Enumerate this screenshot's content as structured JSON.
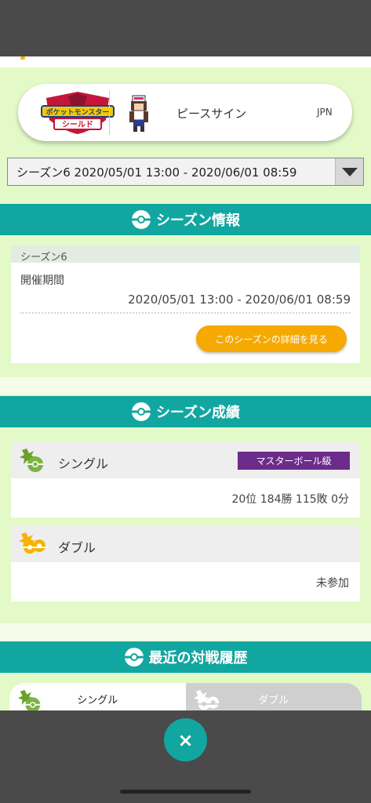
{
  "profile": {
    "game_logo_text_top": "ポケットモンスター",
    "game_logo_text_bottom": "シールド",
    "trainer_name": "ピースサイン",
    "region": "JPN"
  },
  "season_selector": {
    "selected": "シーズン6 2020/05/01 13:00 - 2020/06/01 08:59"
  },
  "season_info": {
    "header": "シーズン情報",
    "season_label": "シーズン6",
    "period_label": "開催期間",
    "period_value": "2020/05/01 13:00 - 2020/06/01 08:59",
    "detail_button": "このシーズンの詳細を見る"
  },
  "season_results": {
    "header": "シーズン成績",
    "single": {
      "label": "シングル",
      "rank_badge": "マスターボール級",
      "record": "20位 184勝 115敗 0分"
    },
    "double": {
      "label": "ダブル",
      "record": "未参加"
    }
  },
  "battle_history": {
    "header": "最近の対戦履歴",
    "tabs": [
      "シングル",
      "ダブル"
    ]
  },
  "controls": {
    "close_symbol": "×"
  },
  "colors": {
    "teal": "#12a6a0",
    "light_green_bg": "#e3fac8",
    "orange_button": "#f6a900",
    "master_ball_purple": "#6b2c8a"
  },
  "icons": {
    "section": "pokeball-icon",
    "single": "single-battle-icon",
    "double": "double-battle-icon",
    "close": "close-icon"
  }
}
